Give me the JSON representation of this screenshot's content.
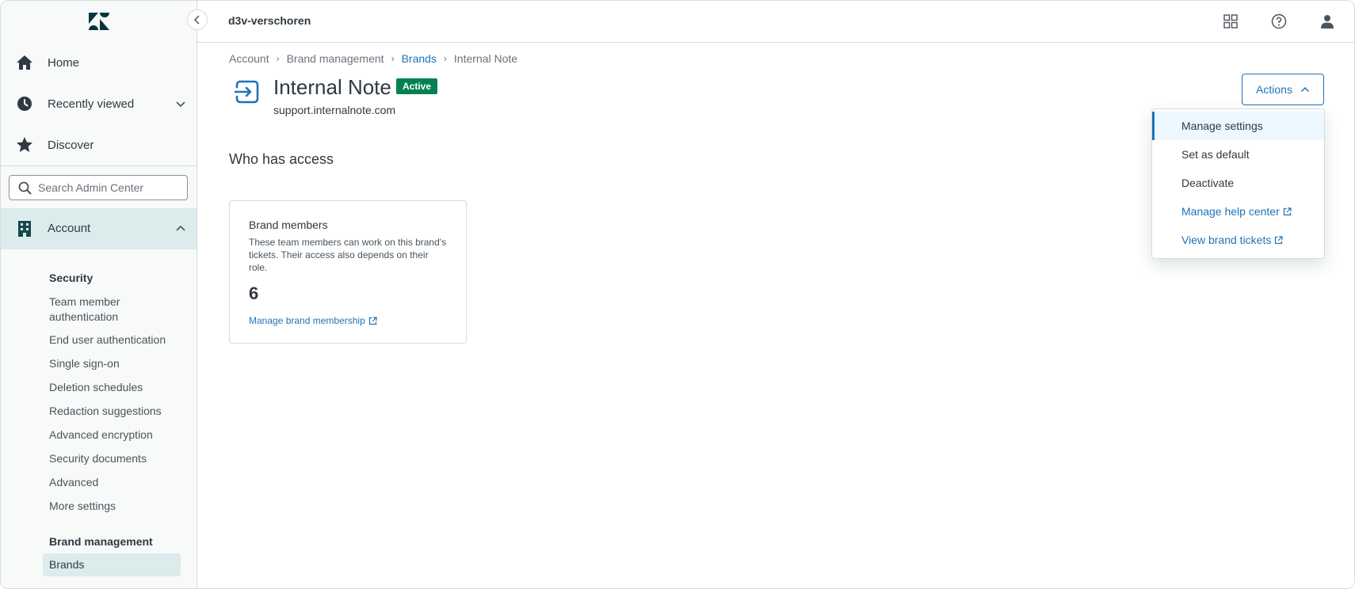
{
  "topbar": {
    "workspace": "d3v-verschoren"
  },
  "sidebar": {
    "nav": [
      {
        "label": "Home",
        "icon": "home-icon"
      },
      {
        "label": "Recently viewed",
        "icon": "clock-icon"
      },
      {
        "label": "Discover",
        "icon": "star-icon"
      }
    ],
    "search_placeholder": "Search Admin Center",
    "account_label": "Account",
    "security_heading": "Security",
    "security_items": [
      "Team member authentication",
      "End user authentication",
      "Single sign-on",
      "Deletion schedules",
      "Redaction suggestions",
      "Advanced encryption",
      "Security documents",
      "Advanced",
      "More settings"
    ],
    "brand_heading": "Brand management",
    "brand_items": [
      "Brands"
    ]
  },
  "breadcrumb": [
    "Account",
    "Brand management",
    "Brands",
    "Internal Note"
  ],
  "brand": {
    "name": "Internal Note",
    "status": "Active",
    "domain": "support.internalnote.com"
  },
  "section_title": "Who has access",
  "card": {
    "title": "Brand members",
    "description": "These team members can work on this brand's tickets. Their access also depends on their role.",
    "count": "6",
    "link": "Manage brand membership"
  },
  "actions": {
    "label": "Actions",
    "menu": [
      "Manage settings",
      "Set as default",
      "Deactivate",
      "Manage help center",
      "View brand tickets"
    ]
  },
  "colors": {
    "accent": "#1f73b7",
    "active_badge": "#038153",
    "selected_bg": "#dcecec"
  }
}
